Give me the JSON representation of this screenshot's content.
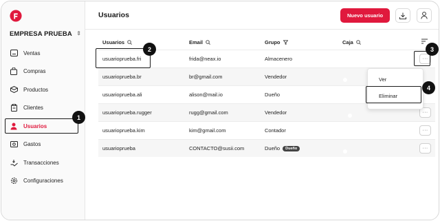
{
  "company": {
    "name": "EMPRESA PRUEBA"
  },
  "sidebar": {
    "items": [
      {
        "label": "Ventas",
        "icon": "sales-icon"
      },
      {
        "label": "Compras",
        "icon": "bag-icon"
      },
      {
        "label": "Productos",
        "icon": "box-icon"
      },
      {
        "label": "Clientes",
        "icon": "clipboard-icon"
      },
      {
        "label": "Usuarios",
        "icon": "user-icon",
        "active": true
      },
      {
        "label": "Gastos",
        "icon": "money-icon"
      },
      {
        "label": "Transacciones",
        "icon": "transactions-icon"
      },
      {
        "label": "Configuraciones",
        "icon": "gear-icon"
      }
    ]
  },
  "header": {
    "title": "Usuarios",
    "new_button": "Nuevo usuario"
  },
  "table": {
    "columns": [
      "Usuarios",
      "Email",
      "Grupo",
      "Caja"
    ],
    "rows": [
      {
        "user": "usuarioprueba.fri",
        "email": "frida@neax.io",
        "group": "Almacenero",
        "caja": false
      },
      {
        "user": "usuarioprueba.br",
        "email": "br@gmail.com",
        "group": "Vendedor",
        "caja": false
      },
      {
        "user": "usuarioprueba.ali",
        "email": "alison@mail.io",
        "group": "Dueño",
        "caja": false
      },
      {
        "user": "usuarioprueba.rugger",
        "email": "rugg@gmail.com",
        "group": "Vendedor",
        "caja": true
      },
      {
        "user": "usuarioprueba.kim",
        "email": "kim@gmail.com",
        "group": "Contador",
        "caja": true
      },
      {
        "user": "usuarioprueba",
        "email": "CONTACTO@susii.com",
        "group": "Dueño",
        "badge": "Dueño",
        "caja": false
      }
    ],
    "more_label": "···"
  },
  "dropdown": {
    "items": [
      "Ver",
      "Eliminar"
    ]
  },
  "callouts": [
    "1",
    "2",
    "3",
    "4"
  ],
  "colors": {
    "accent": "#e0193d",
    "text": "#1a1a1a",
    "toggle_off": "#dcdcdc"
  }
}
